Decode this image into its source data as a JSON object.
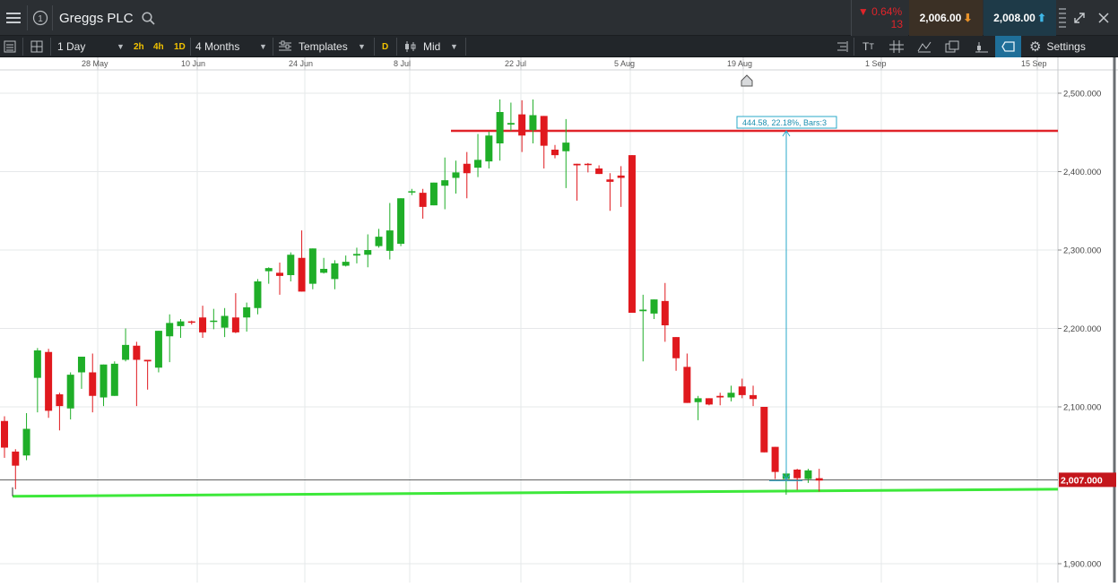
{
  "header": {
    "instrument": "Greggs PLC",
    "change_pct": "0.64%",
    "change_val": "13",
    "sell_price": "2,006.00",
    "buy_price": "2,008.00",
    "colors": {
      "bg": "#2b2f33",
      "down": "#e0242a",
      "sell_bg": "#3b3025",
      "buy_bg": "#1e3a48"
    }
  },
  "toolbar": {
    "interval": "1 Day",
    "quick_intervals": [
      "2h",
      "4h",
      "1D"
    ],
    "range": "4 Months",
    "templates": "Templates",
    "d_tag": "D",
    "price_type": "Mid",
    "settings": "Settings"
  },
  "chart_data": {
    "type": "candlestick",
    "x_ticks": [
      "28 May",
      "10 Jun",
      "24 Jun",
      "8 Jul",
      "22 Jul",
      "5 Aug",
      "19 Aug",
      "1 Sep",
      "15 Sep"
    ],
    "y_ticks": [
      "2,500.000",
      "2,400.000",
      "2,300.000",
      "2,200.000",
      "2,100.000",
      "1,900.000"
    ],
    "ylim": [
      1900,
      2520
    ],
    "last_price_label": "2,007.000",
    "last_price": 2007,
    "candles": [
      [
        2082,
        2088,
        2035,
        2048
      ],
      [
        2043,
        2046,
        1995,
        2025
      ],
      [
        2038,
        2092,
        2032,
        2072
      ],
      [
        2137,
        2175,
        2093,
        2172
      ],
      [
        2170,
        2174,
        2086,
        2095
      ],
      [
        2116,
        2118,
        2070,
        2101
      ],
      [
        2098,
        2144,
        2084,
        2141
      ],
      [
        2144,
        2158,
        2123,
        2164
      ],
      [
        2144,
        2168,
        2093,
        2114
      ],
      [
        2112,
        2153,
        2101,
        2154
      ],
      [
        2114,
        2158,
        2114,
        2155
      ],
      [
        2160,
        2200,
        2158,
        2179
      ],
      [
        2178,
        2183,
        2101,
        2160
      ],
      [
        2160,
        2158,
        2122,
        2158
      ],
      [
        2150,
        2171,
        2144,
        2197
      ],
      [
        2190,
        2218,
        2157,
        2207
      ],
      [
        2203,
        2212,
        2188,
        2209
      ],
      [
        2209,
        2210,
        2205,
        2208
      ],
      [
        2214,
        2229,
        2188,
        2195
      ],
      [
        2210,
        2225,
        2199,
        2210
      ],
      [
        2201,
        2226,
        2189,
        2216
      ],
      [
        2214,
        2245,
        2194,
        2195
      ],
      [
        2214,
        2233,
        2196,
        2227
      ],
      [
        2226,
        2263,
        2218,
        2260
      ],
      [
        2273,
        2278,
        2257,
        2277
      ],
      [
        2271,
        2284,
        2243,
        2267
      ],
      [
        2268,
        2297,
        2260,
        2294
      ],
      [
        2290,
        2325,
        2281,
        2247
      ],
      [
        2257,
        2265,
        2250,
        2302
      ],
      [
        2271,
        2290,
        2270,
        2276
      ],
      [
        2263,
        2287,
        2250,
        2283
      ],
      [
        2280,
        2293,
        2279,
        2285
      ],
      [
        2293,
        2303,
        2283,
        2295
      ],
      [
        2294,
        2320,
        2278,
        2300
      ],
      [
        2305,
        2327,
        2303,
        2317
      ],
      [
        2299,
        2360,
        2288,
        2325
      ],
      [
        2308,
        2317,
        2305,
        2366
      ],
      [
        2374,
        2378,
        2370,
        2375
      ],
      [
        2373,
        2378,
        2340,
        2355
      ],
      [
        2357,
        2386,
        2358,
        2386
      ],
      [
        2382,
        2418,
        2352,
        2389
      ],
      [
        2392,
        2414,
        2372,
        2399
      ],
      [
        2410,
        2425,
        2366,
        2398
      ],
      [
        2405,
        2448,
        2393,
        2415
      ],
      [
        2413,
        2451,
        2404,
        2446
      ],
      [
        2436,
        2492,
        2414,
        2476
      ],
      [
        2460,
        2488,
        2452,
        2462
      ],
      [
        2473,
        2491,
        2425,
        2446
      ],
      [
        2453,
        2492,
        2436,
        2472
      ],
      [
        2471,
        2470,
        2404,
        2433
      ],
      [
        2428,
        2434,
        2417,
        2421
      ],
      [
        2426,
        2467,
        2379,
        2437
      ],
      [
        2410,
        2403,
        2363,
        2408
      ],
      [
        2410,
        2411,
        2399,
        2409
      ],
      [
        2404,
        2408,
        2397,
        2397
      ],
      [
        2390,
        2398,
        2350,
        2387
      ],
      [
        2395,
        2407,
        2355,
        2392
      ],
      [
        2421,
        2418,
        2319,
        2220
      ],
      [
        2222,
        2243,
        2158,
        2224
      ],
      [
        2219,
        2228,
        2212,
        2237
      ],
      [
        2235,
        2258,
        2183,
        2204
      ],
      [
        2189,
        2178,
        2146,
        2162
      ],
      [
        2151,
        2168,
        2141,
        2105
      ],
      [
        2106,
        2114,
        2083,
        2111
      ],
      [
        2111,
        2110,
        2102,
        2103
      ],
      [
        2114,
        2118,
        2102,
        2112
      ],
      [
        2112,
        2127,
        2107,
        2118
      ],
      [
        2126,
        2136,
        2111,
        2115
      ],
      [
        2115,
        2127,
        2101,
        2110
      ],
      [
        2100,
        2098,
        2052,
        2042
      ],
      [
        2049,
        2043,
        2008,
        2017
      ],
      [
        2008,
        2018,
        1988,
        2015
      ],
      [
        2020,
        2021,
        1994,
        2009
      ],
      [
        2008,
        2021,
        2003,
        2019
      ],
      [
        2009,
        2021,
        1992,
        2006
      ]
    ],
    "horizontal_lines": [
      {
        "kind": "resistance",
        "value": 2452,
        "color": "#e0242a"
      },
      {
        "kind": "current",
        "value": 2007,
        "color": "#2e2e2e"
      }
    ],
    "support_trendline": {
      "from": 1986,
      "to": 1995,
      "color": "#3de83a"
    },
    "measure": {
      "label": "444.58, 22.18%, Bars:3",
      "from": 2452,
      "to": 2007,
      "color": "#2aa9c9"
    },
    "grid": true
  }
}
